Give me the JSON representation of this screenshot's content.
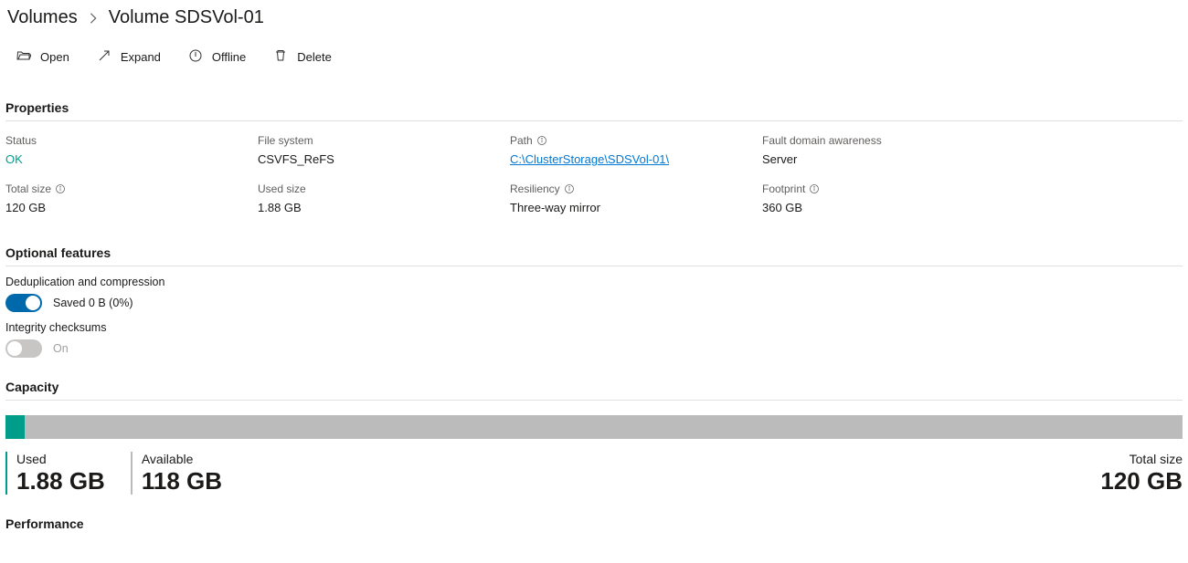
{
  "breadcrumb": {
    "root": "Volumes",
    "current": "Volume SDSVol-01"
  },
  "toolbar": {
    "open": "Open",
    "expand": "Expand",
    "offline": "Offline",
    "delete": "Delete"
  },
  "sections": {
    "properties": "Properties",
    "optional": "Optional features",
    "capacity": "Capacity",
    "performance": "Performance"
  },
  "properties": {
    "status_l": "Status",
    "status_v": "OK",
    "fs_l": "File system",
    "fs_v": "CSVFS_ReFS",
    "path_l": "Path",
    "path_v": "C:\\ClusterStorage\\SDSVol-01\\",
    "fda_l": "Fault domain awareness",
    "fda_v": "Server",
    "tsize_l": "Total size",
    "tsize_v": "120 GB",
    "usize_l": "Used size",
    "usize_v": "1.88 GB",
    "res_l": "Resiliency",
    "res_v": "Three-way mirror",
    "foot_l": "Footprint",
    "foot_v": "360 GB"
  },
  "optional": {
    "dedup_l": "Deduplication and compression",
    "dedup_s": "Saved 0 B (0%)",
    "integ_l": "Integrity checksums",
    "integ_s": "On"
  },
  "capacity": {
    "used_l": "Used",
    "used_v": "1.88 GB",
    "avail_l": "Available",
    "avail_v": "118 GB",
    "total_l": "Total size",
    "total_v": "120 GB",
    "used_pct": 1.6
  }
}
